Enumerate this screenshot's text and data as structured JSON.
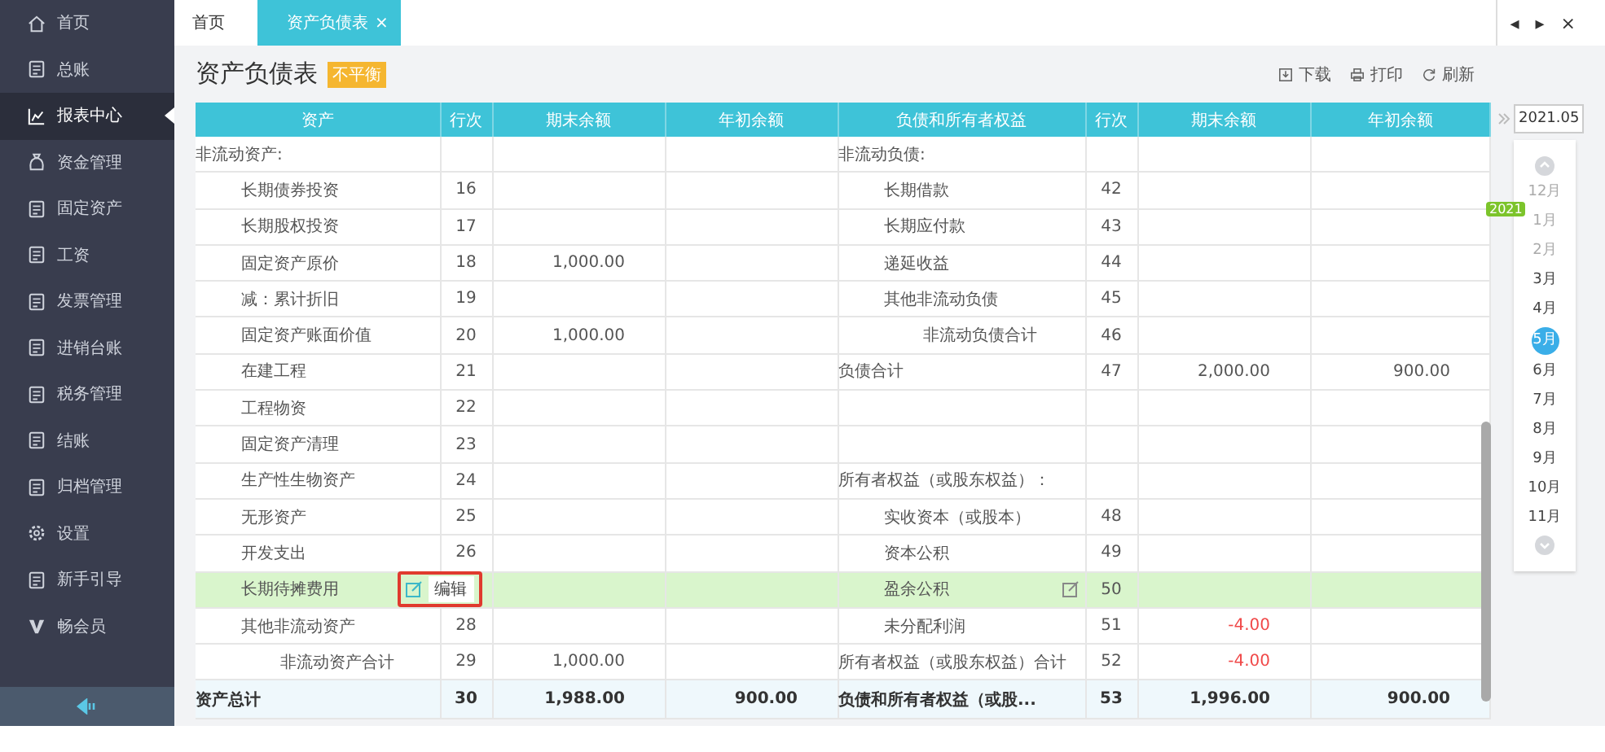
{
  "sidebar": {
    "items": [
      {
        "label": "首页",
        "selected": false
      },
      {
        "label": "总账",
        "selected": false
      },
      {
        "label": "报表中心",
        "selected": true
      },
      {
        "label": "资金管理",
        "selected": false
      },
      {
        "label": "固定资产",
        "selected": false
      },
      {
        "label": "工资",
        "selected": false
      },
      {
        "label": "发票管理",
        "selected": false
      },
      {
        "label": "进销台账",
        "selected": false
      },
      {
        "label": "税务管理",
        "selected": false
      },
      {
        "label": "结账",
        "selected": false
      },
      {
        "label": "归档管理",
        "selected": false
      },
      {
        "label": "设置",
        "selected": false
      },
      {
        "label": "新手引导",
        "selected": false
      },
      {
        "label": "畅会员",
        "selected": false
      }
    ]
  },
  "tabs": [
    {
      "label": "首页",
      "selected": false
    },
    {
      "label": "资产负债表",
      "selected": true,
      "close": "×"
    }
  ],
  "window_controls": [
    "◂",
    "▸",
    "×"
  ],
  "page": {
    "title": "资产负债表",
    "badge": "不平衡",
    "actions": [
      "下载",
      "打印",
      "刷新"
    ]
  },
  "table": {
    "columns": [
      "资产",
      "行次",
      "期末余额",
      "年初余额",
      "负债和所有者权益",
      "行次",
      "期末余额",
      "年初余额"
    ],
    "rows": [
      {
        "kind": "normal",
        "highlighted": false,
        "left": {
          "kind": "heading",
          "name": "非流动资产:"
        },
        "right": {
          "kind": "heading",
          "name": "非流动负债:"
        }
      },
      {
        "kind": "normal",
        "highlighted": false,
        "left": {
          "kind": "item",
          "name": "长期债券投资",
          "no": "16"
        },
        "right": {
          "kind": "item",
          "name": "长期借款",
          "no": "42"
        }
      },
      {
        "kind": "normal",
        "highlighted": false,
        "left": {
          "kind": "item",
          "name": "长期股权投资",
          "no": "17"
        },
        "right": {
          "kind": "item",
          "name": "长期应付款",
          "no": "43"
        }
      },
      {
        "kind": "normal",
        "highlighted": false,
        "left": {
          "kind": "item",
          "name": "固定资产原价",
          "no": "18",
          "end": "1,000.00",
          "negative": false
        },
        "right": {
          "kind": "item",
          "name": "递延收益",
          "no": "44"
        }
      },
      {
        "kind": "normal",
        "highlighted": false,
        "left": {
          "kind": "item",
          "name": "减：累计折旧",
          "no": "19"
        },
        "right": {
          "kind": "item",
          "name": "其他非流动负债",
          "no": "45"
        }
      },
      {
        "kind": "normal",
        "highlighted": false,
        "left": {
          "kind": "item",
          "name": "固定资产账面价值",
          "no": "20",
          "end": "1,000.00",
          "negative": false
        },
        "right": {
          "kind": "subtotal",
          "name": "非流动负债合计",
          "no": "46"
        }
      },
      {
        "kind": "normal",
        "highlighted": false,
        "left": {
          "kind": "item",
          "name": "在建工程",
          "no": "21"
        },
        "right": {
          "kind": "heading",
          "name": "负债合计",
          "no": "47",
          "end": "2,000.00",
          "begin": "900.00",
          "negative": false
        }
      },
      {
        "kind": "normal",
        "highlighted": false,
        "left": {
          "kind": "item",
          "name": "工程物资",
          "no": "22"
        },
        "right": {
          "kind": "blank"
        }
      },
      {
        "kind": "normal",
        "highlighted": false,
        "left": {
          "kind": "item",
          "name": "固定资产清理",
          "no": "23"
        },
        "right": {
          "kind": "blank"
        }
      },
      {
        "kind": "normal",
        "highlighted": false,
        "left": {
          "kind": "item",
          "name": "生产性生物资产",
          "no": "24"
        },
        "right": {
          "kind": "heading",
          "name": "所有者权益（或股东权益）："
        }
      },
      {
        "kind": "normal",
        "highlighted": false,
        "left": {
          "kind": "item",
          "name": "无形资产",
          "no": "25"
        },
        "right": {
          "kind": "item",
          "name": "实收资本（或股本）",
          "no": "48"
        }
      },
      {
        "kind": "normal",
        "highlighted": false,
        "left": {
          "kind": "item",
          "name": "开发支出",
          "no": "26"
        },
        "right": {
          "kind": "item",
          "name": "资本公积",
          "no": "49"
        }
      },
      {
        "kind": "normal",
        "highlighted": true,
        "left": {
          "kind": "item",
          "name": "长期待摊费用",
          "edit_tooltip": "编辑"
        },
        "right": {
          "kind": "item",
          "name": "盈余公积",
          "no": "50"
        }
      },
      {
        "kind": "normal",
        "highlighted": false,
        "left": {
          "kind": "item",
          "name": "其他非流动资产",
          "no": "28"
        },
        "right": {
          "kind": "item",
          "name": "未分配利润",
          "no": "51",
          "end": "-4.00",
          "negative": true
        }
      },
      {
        "kind": "normal",
        "highlighted": false,
        "left": {
          "kind": "subtotal",
          "name": "非流动资产合计",
          "no": "29",
          "end": "1,000.00",
          "negative": false
        },
        "right": {
          "kind": "heading",
          "name": "所有者权益（或股东权益）合计",
          "no": "52",
          "end": "-4.00",
          "negative": true
        }
      },
      {
        "kind": "total",
        "highlighted": false,
        "left": {
          "kind": "total",
          "name": "资产总计",
          "no": "30",
          "end": "1,988.00",
          "begin": "900.00",
          "negative": false
        },
        "right": {
          "kind": "total",
          "name": "负债和所有者权益（或股...",
          "no": "53",
          "end": "1,996.00",
          "begin": "900.00",
          "negative": false
        }
      }
    ]
  },
  "period": {
    "value": "2021.05",
    "year_badge": "2021",
    "months": [
      {
        "label": "12月",
        "selected": false,
        "disabled": true
      },
      {
        "label": "1月",
        "selected": false,
        "disabled": true
      },
      {
        "label": "2月",
        "selected": false,
        "disabled": true
      },
      {
        "label": "3月",
        "selected": false,
        "disabled": false
      },
      {
        "label": "4月",
        "selected": false,
        "disabled": false
      },
      {
        "label": "5月",
        "selected": true,
        "disabled": false
      },
      {
        "label": "6月",
        "selected": false,
        "disabled": false
      },
      {
        "label": "7月",
        "selected": false,
        "disabled": false
      },
      {
        "label": "8月",
        "selected": false,
        "disabled": false
      },
      {
        "label": "9月",
        "selected": false,
        "disabled": false
      },
      {
        "label": "10月",
        "selected": false,
        "disabled": false
      },
      {
        "label": "11月",
        "selected": false,
        "disabled": false
      }
    ]
  }
}
